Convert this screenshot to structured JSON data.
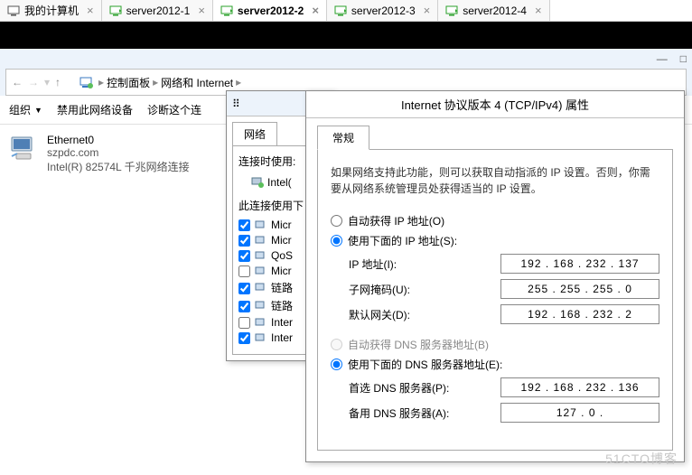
{
  "tabs": [
    {
      "label": "我的计算机",
      "iconColor": "#555",
      "active": false
    },
    {
      "label": "server2012-1",
      "iconColor": "#2aa02a",
      "active": false
    },
    {
      "label": "server2012-2",
      "iconColor": "#2aa02a",
      "active": true
    },
    {
      "label": "server2012-3",
      "iconColor": "#2aa02a",
      "active": false
    },
    {
      "label": "server2012-4",
      "iconColor": "#2aa02a",
      "active": false
    }
  ],
  "titlebar": {
    "min": "—",
    "max": "□"
  },
  "breadcrumb": {
    "back": "←",
    "fwd": "→",
    "up": "↑",
    "items": [
      "控制面板",
      "网络和 Internet"
    ]
  },
  "toolbar": {
    "org": "组织",
    "disable": "禁用此网络设备",
    "diag": "诊断这个连"
  },
  "adapter": {
    "name": "Ethernet0",
    "domain": "szpdc.com",
    "desc": "Intel(R) 82574L 千兆网络连接"
  },
  "status_dialog": {
    "tab": "网络",
    "conn_using": "连接时使用:",
    "conn_adapter": "Intel(",
    "uses_hdr": "此连接使用下",
    "items": [
      {
        "checked": true,
        "label": "Micr"
      },
      {
        "checked": true,
        "label": "Micr"
      },
      {
        "checked": true,
        "label": "QoS"
      },
      {
        "checked": false,
        "label": "Micr"
      },
      {
        "checked": true,
        "label": "链路"
      },
      {
        "checked": true,
        "label": "链路"
      },
      {
        "checked": false,
        "label": "Inter"
      },
      {
        "checked": true,
        "label": "Inter"
      }
    ]
  },
  "prop_dialog": {
    "title": "Internet 协议版本 4 (TCP/IPv4) 属性",
    "tab": "常规",
    "help": "如果网络支持此功能，则可以获取自动指派的 IP 设置。否则，你需要从网络系统管理员处获得适当的 IP 设置。",
    "radio_auto_ip": "自动获得 IP 地址(O)",
    "radio_manual_ip": "使用下面的 IP 地址(S):",
    "fields_ip": [
      {
        "label": "IP 地址(I):",
        "value": "192 . 168 . 232 . 137"
      },
      {
        "label": "子网掩码(U):",
        "value": "255 . 255 . 255 .   0"
      },
      {
        "label": "默认网关(D):",
        "value": "192 . 168 . 232 .   2"
      }
    ],
    "radio_auto_dns": "自动获得 DNS 服务器地址(B)",
    "radio_manual_dns": "使用下面的 DNS 服务器地址(E):",
    "fields_dns": [
      {
        "label": "首选 DNS 服务器(P):",
        "value": "192 . 168 . 232 . 136"
      },
      {
        "label": "备用 DNS 服务器(A):",
        "value": "127 .   0 .            "
      }
    ]
  },
  "watermark": "51CTO博客"
}
